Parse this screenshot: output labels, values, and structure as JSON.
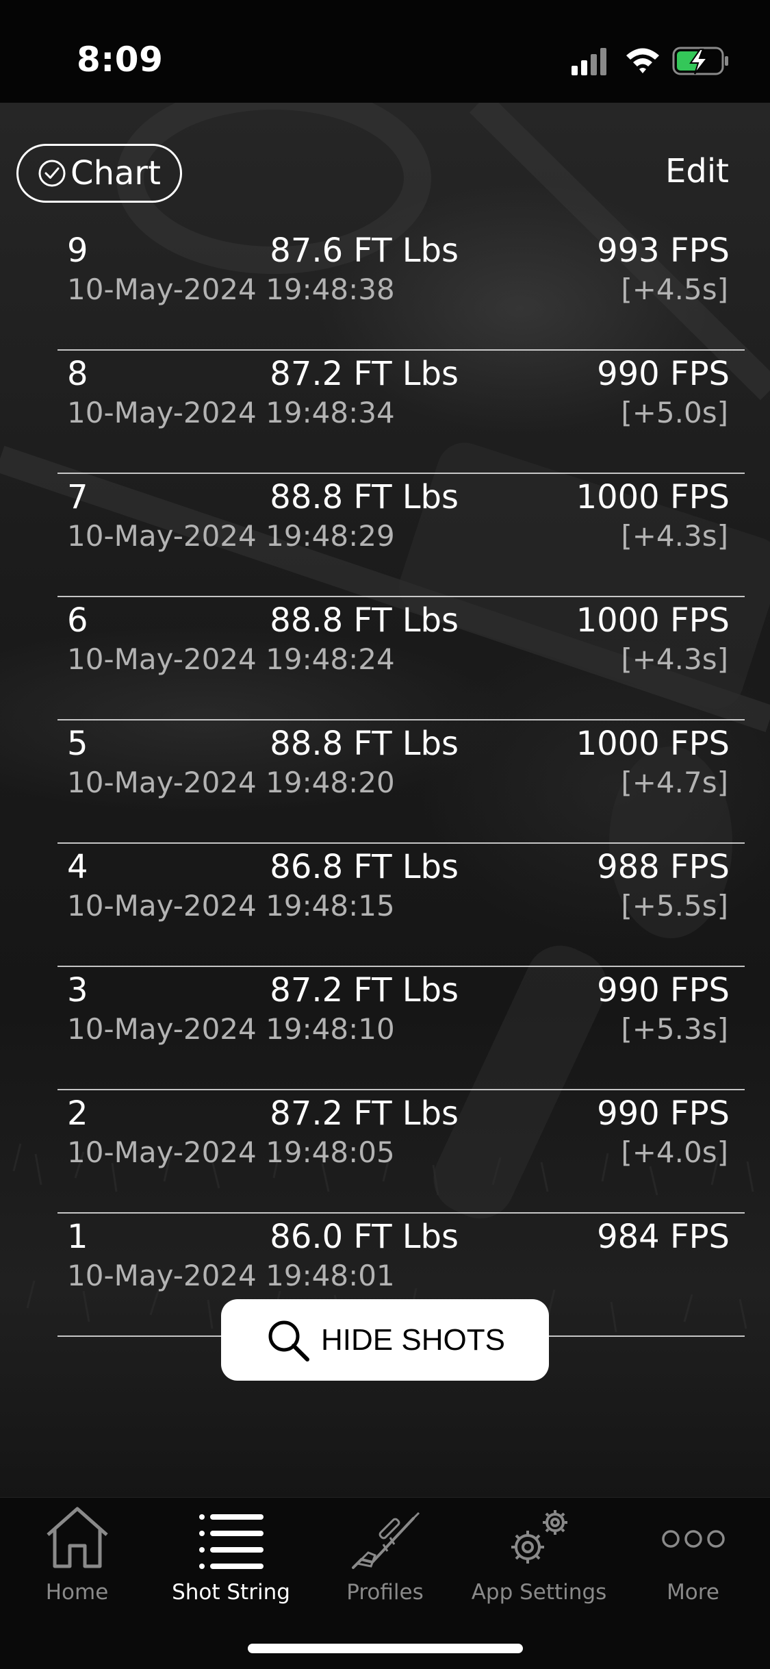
{
  "status_bar": {
    "time": "8:09"
  },
  "toolbar": {
    "chart_label": "Chart",
    "edit_label": "Edit"
  },
  "shots": [
    {
      "number": "9",
      "energy": "87.6 FT Lbs",
      "velocity": "993 FPS",
      "timestamp": "10-May-2024 19:48:38",
      "delta": "[+4.5s]"
    },
    {
      "number": "8",
      "energy": "87.2 FT Lbs",
      "velocity": "990 FPS",
      "timestamp": "10-May-2024 19:48:34",
      "delta": "[+5.0s]"
    },
    {
      "number": "7",
      "energy": "88.8 FT Lbs",
      "velocity": "1000 FPS",
      "timestamp": "10-May-2024 19:48:29",
      "delta": "[+4.3s]"
    },
    {
      "number": "6",
      "energy": "88.8 FT Lbs",
      "velocity": "1000 FPS",
      "timestamp": "10-May-2024 19:48:24",
      "delta": "[+4.3s]"
    },
    {
      "number": "5",
      "energy": "88.8 FT Lbs",
      "velocity": "1000 FPS",
      "timestamp": "10-May-2024 19:48:20",
      "delta": "[+4.7s]"
    },
    {
      "number": "4",
      "energy": "86.8 FT Lbs",
      "velocity": "988 FPS",
      "timestamp": "10-May-2024 19:48:15",
      "delta": "[+5.5s]"
    },
    {
      "number": "3",
      "energy": "87.2 FT Lbs",
      "velocity": "990 FPS",
      "timestamp": "10-May-2024 19:48:10",
      "delta": "[+5.3s]"
    },
    {
      "number": "2",
      "energy": "87.2 FT Lbs",
      "velocity": "990 FPS",
      "timestamp": "10-May-2024 19:48:05",
      "delta": "[+4.0s]"
    },
    {
      "number": "1",
      "energy": "86.0 FT Lbs",
      "velocity": "984 FPS",
      "timestamp": "10-May-2024 19:48:01",
      "delta": ""
    }
  ],
  "hide_shots": {
    "label": "HIDE SHOTS",
    "icon": "search-icon"
  },
  "tab_bar": {
    "active": "Shot String",
    "items": [
      {
        "label": "Home",
        "icon": "home-icon"
      },
      {
        "label": "Shot String",
        "icon": "list-icon"
      },
      {
        "label": "Profiles",
        "icon": "rifle-icon"
      },
      {
        "label": "App Settings",
        "icon": "gears-icon"
      },
      {
        "label": "More",
        "icon": "more-icon"
      }
    ]
  },
  "colors": {
    "active_tab": "#ffffff",
    "inactive_tab": "#8a8a8a",
    "secondary_text": "#b3b3b3"
  }
}
